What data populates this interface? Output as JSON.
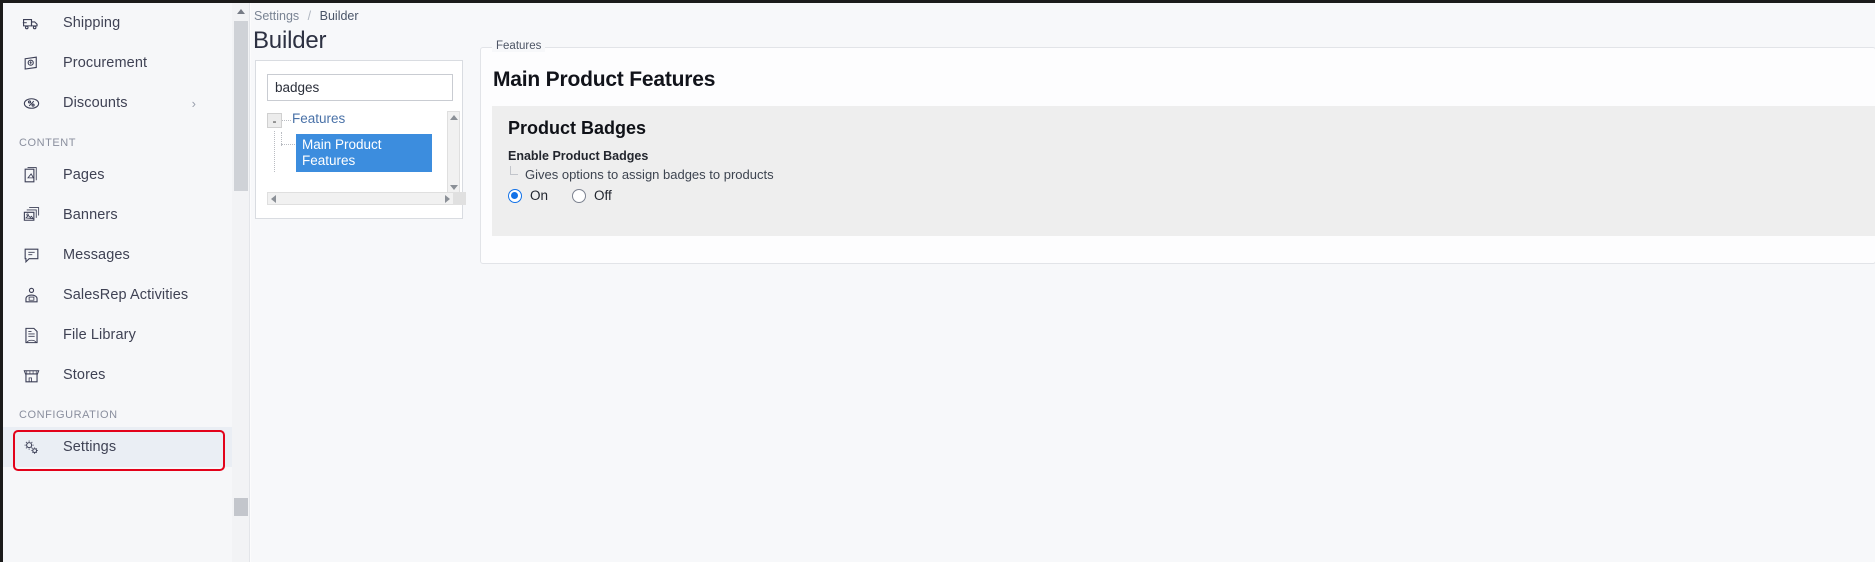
{
  "sidebar": {
    "items": [
      {
        "label": "Shipping",
        "icon": "truck-icon",
        "chevron": false,
        "section": null
      },
      {
        "label": "Procurement",
        "icon": "procurement-icon",
        "chevron": false,
        "section": null
      },
      {
        "label": "Discounts",
        "icon": "discount-tag-icon",
        "chevron": true,
        "section": null
      },
      {
        "label": "Pages",
        "icon": "page-edit-icon",
        "chevron": false,
        "section": "CONTENT"
      },
      {
        "label": "Banners",
        "icon": "banners-icon",
        "chevron": false,
        "section": null
      },
      {
        "label": "Messages",
        "icon": "message-icon",
        "chevron": false,
        "section": null
      },
      {
        "label": "SalesRep Activities",
        "icon": "salesrep-icon",
        "chevron": false,
        "section": null
      },
      {
        "label": "File Library",
        "icon": "file-library-icon",
        "chevron": false,
        "section": null
      },
      {
        "label": "Stores",
        "icon": "store-icon",
        "chevron": false,
        "section": null
      },
      {
        "label": "Settings",
        "icon": "gears-icon",
        "chevron": false,
        "section": "CONFIGURATION"
      }
    ],
    "sections": {
      "content": "CONTENT",
      "configuration": "CONFIGURATION"
    },
    "selected": "Settings",
    "highlight_color": "#e3021a",
    "chevron_glyph": "›"
  },
  "breadcrumb": {
    "root": "Settings",
    "separator": "/",
    "current": "Builder"
  },
  "page": {
    "title": "Builder"
  },
  "tree_panel": {
    "search": {
      "value": "badges",
      "placeholder": ""
    },
    "root": {
      "label": "Features",
      "toggle": "-",
      "expanded": true
    },
    "selected_node": "Main Product Features",
    "selected_color": "#3c8dde"
  },
  "main_panel": {
    "legend": "Features",
    "heading": "Main Product Features",
    "section": {
      "title": "Product Badges",
      "setting_label": "Enable Product Badges",
      "setting_description": "Gives options to assign badges to products",
      "options": [
        {
          "label": "On",
          "selected": true
        },
        {
          "label": "Off",
          "selected": false
        }
      ],
      "accent_color": "#1272e8"
    }
  }
}
